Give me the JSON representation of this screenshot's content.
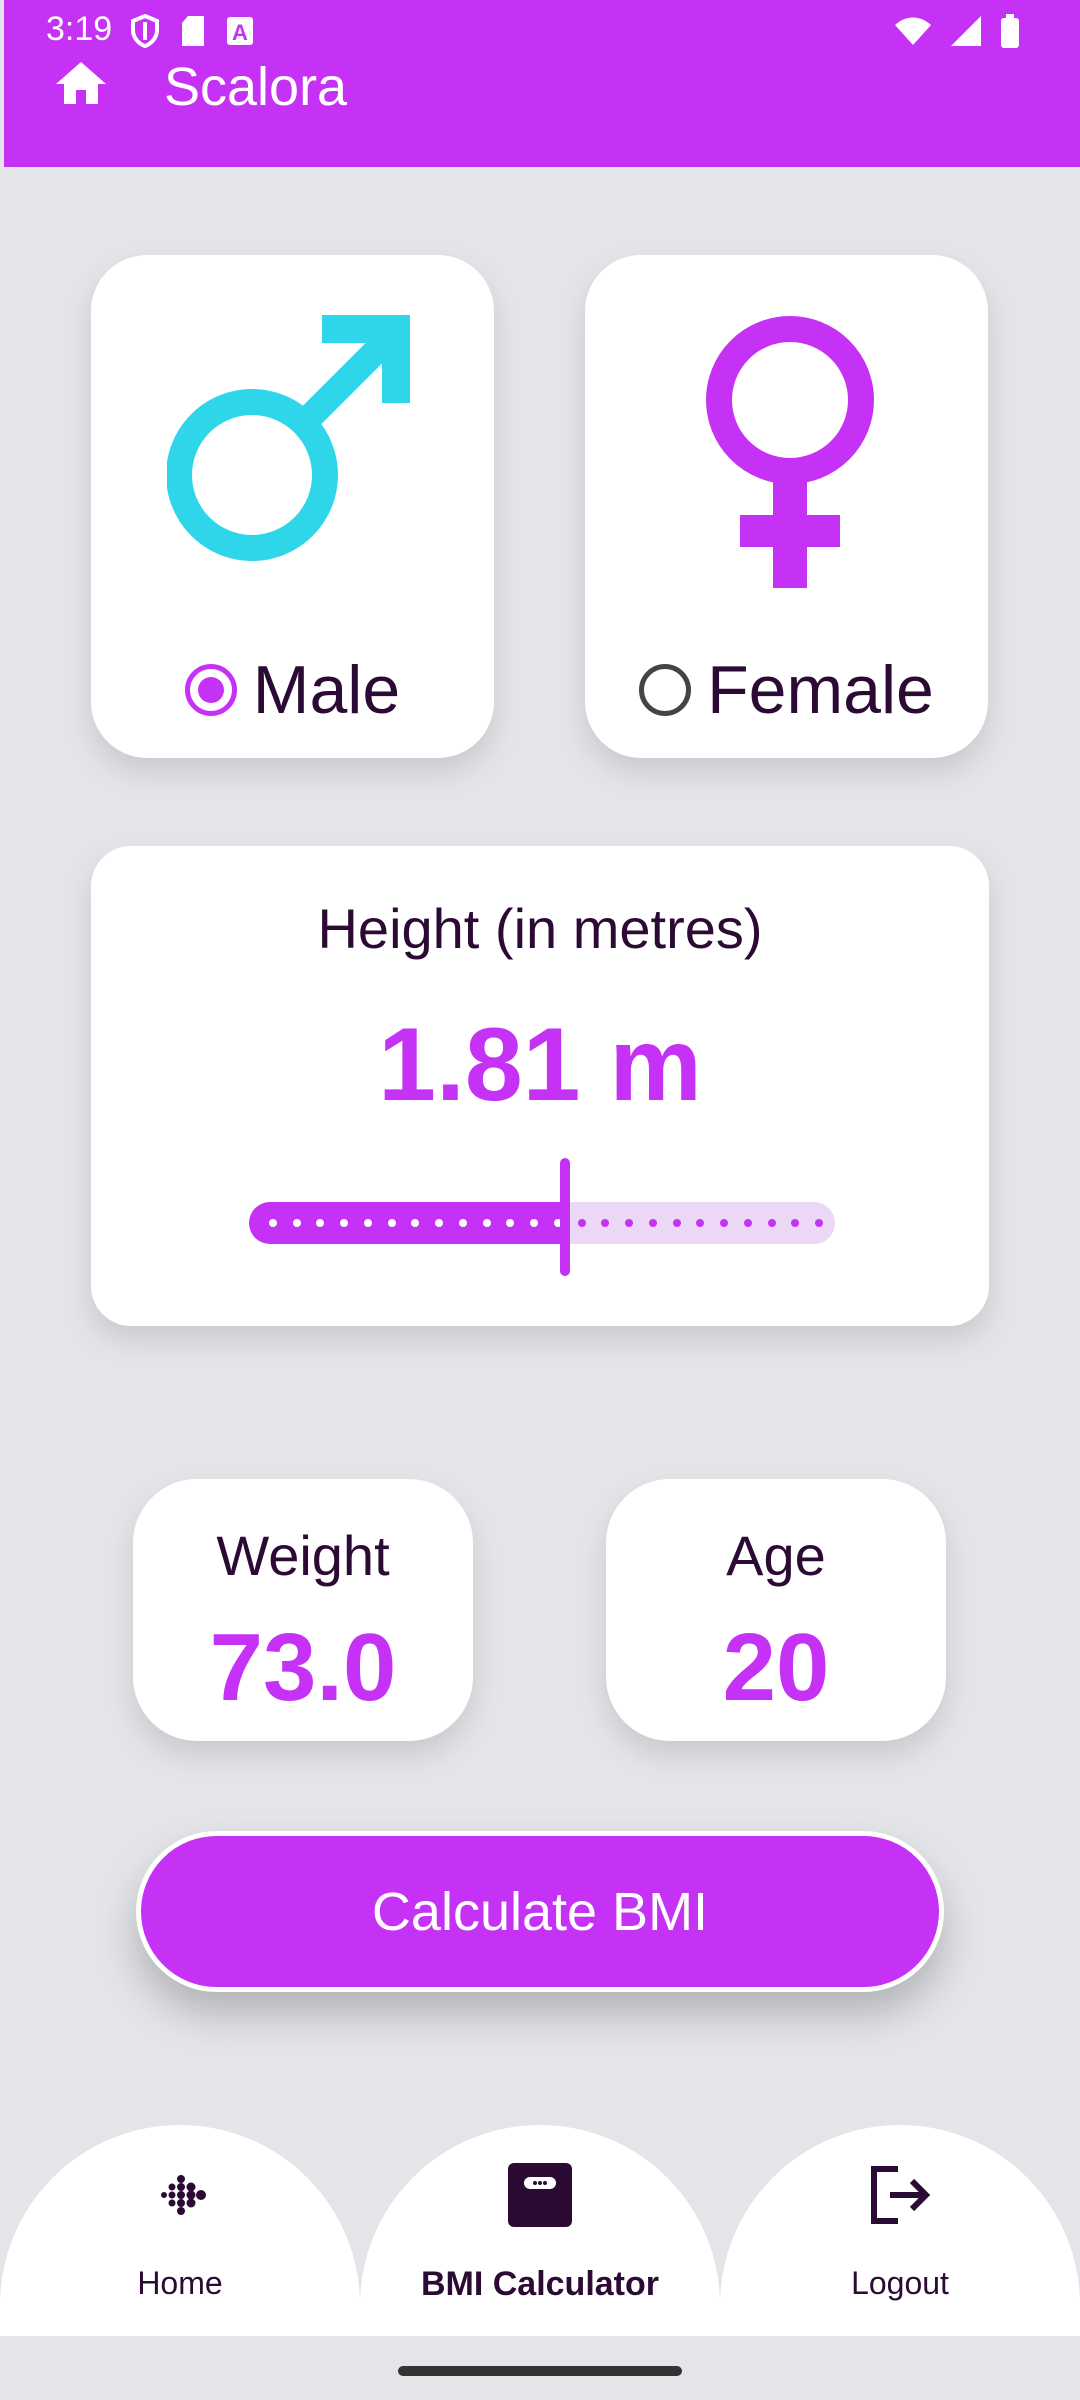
{
  "status_bar": {
    "time": "3:19"
  },
  "app_bar": {
    "title": "Scalora"
  },
  "gender": {
    "male": {
      "label": "Male",
      "selected": true,
      "color": "#2fd6ea"
    },
    "female": {
      "label": "Female",
      "selected": false,
      "color": "#c632f5"
    }
  },
  "height": {
    "title": "Height (in metres)",
    "value_text": "1.81 m",
    "slider_fraction": 0.54
  },
  "weight": {
    "label": "Weight",
    "value": "73.0"
  },
  "age": {
    "label": "Age",
    "value": "20"
  },
  "calculate_button": {
    "label": "Calculate BMI"
  },
  "nav": {
    "items": [
      {
        "label": "Home",
        "icon": "fitbit-dots-icon"
      },
      {
        "label": "BMI Calculator",
        "icon": "scale-icon",
        "active": true
      },
      {
        "label": "Logout",
        "icon": "logout-icon"
      }
    ]
  },
  "colors": {
    "accent": "#c632f5",
    "male": "#2fd6ea",
    "background": "#e4e5e9",
    "text": "#2b0a33"
  }
}
